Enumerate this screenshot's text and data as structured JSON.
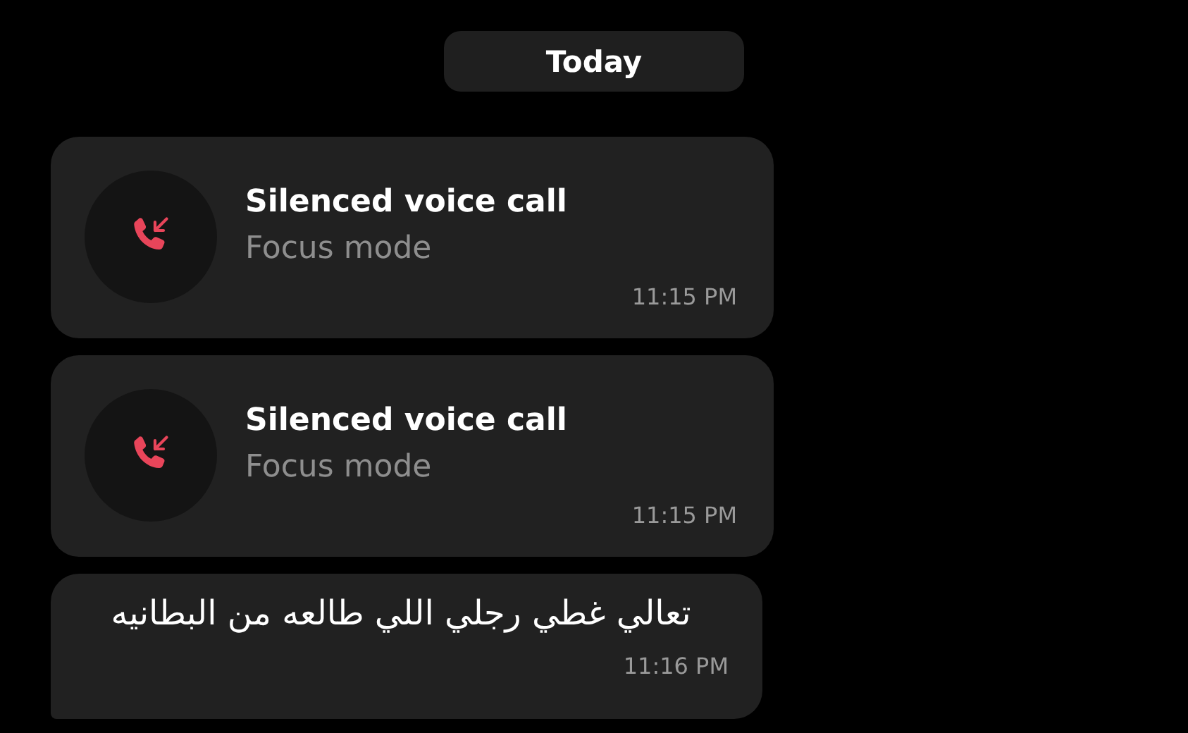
{
  "date_divider": "Today",
  "messages": [
    {
      "kind": "call",
      "title": "Silenced voice call",
      "subtitle": "Focus mode",
      "time": "11:15 PM"
    },
    {
      "kind": "call",
      "title": "Silenced voice call",
      "subtitle": "Focus mode",
      "time": "11:15 PM"
    },
    {
      "kind": "text",
      "text": "تعالي غطي رجلي اللي طالعه من البطانيه",
      "time": "11:16 PM"
    }
  ]
}
